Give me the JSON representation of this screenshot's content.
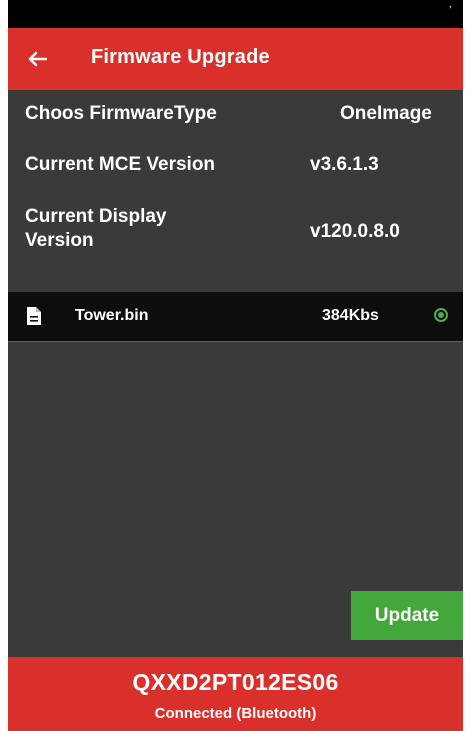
{
  "header": {
    "title": "Firmware Upgrade",
    "back_icon": "arrow-left-icon"
  },
  "info": {
    "firmware_type": {
      "label": "Choos FirmwareType",
      "value": "OneImage"
    },
    "mce_version": {
      "label": "Current MCE Version",
      "value": "v3.6.1.3"
    },
    "display_version": {
      "label_line1": "Current Display",
      "label_line2": "Version",
      "value": "v120.0.8.0"
    }
  },
  "files": [
    {
      "name": "Tower.bin",
      "size": "384Kbs",
      "icon": "file-document-icon",
      "selected": true
    }
  ],
  "actions": {
    "update_label": "Update"
  },
  "footer": {
    "device_id": "QXXD2PT012ES06",
    "connection_status": "Connected (Bluetooth)"
  },
  "colors": {
    "accent": "#d9302b",
    "background": "#3a3a3a",
    "update_button": "#43a83b",
    "radio_selected": "#4caf50"
  }
}
